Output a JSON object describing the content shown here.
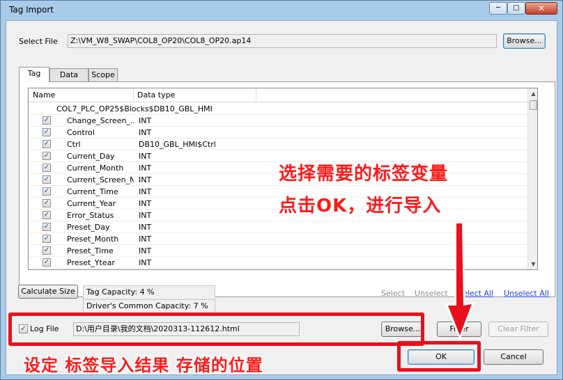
{
  "window": {
    "title": "Tag Import",
    "controls": {
      "minimize": "─",
      "maximize": "□",
      "close": "✕"
    }
  },
  "select_file": {
    "label": "Select File",
    "path": "Z:\\VM_W8_SWAP\\COL8_OP20\\COL8_OP20.ap14",
    "browse_label": "Browse..."
  },
  "tabs": [
    {
      "label": "Tag"
    },
    {
      "label": "Data type"
    },
    {
      "label": "Scope"
    }
  ],
  "list": {
    "columns": {
      "name": "Name",
      "type": "Data type"
    },
    "group": "COL7_PLC_OP25$Blocks$DB10_GBL_HMI",
    "rows": [
      {
        "name": "Change_Screen_...",
        "type": "INT",
        "checked": true
      },
      {
        "name": "Control",
        "type": "INT",
        "checked": true
      },
      {
        "name": "Ctrl",
        "type": "DB10_GBL_HMI$Ctrl",
        "checked": true
      },
      {
        "name": "Current_Day",
        "type": "INT",
        "checked": true
      },
      {
        "name": "Current_Month",
        "type": "INT",
        "checked": true
      },
      {
        "name": "Current_Screen_No",
        "type": "INT",
        "checked": true
      },
      {
        "name": "Current_Time",
        "type": "INT",
        "checked": true
      },
      {
        "name": "Current_Year",
        "type": "INT",
        "checked": true
      },
      {
        "name": "Error_Status",
        "type": "INT",
        "checked": true
      },
      {
        "name": "Preset_Day",
        "type": "INT",
        "checked": true
      },
      {
        "name": "Preset_Month",
        "type": "INT",
        "checked": true
      },
      {
        "name": "Preset_Time",
        "type": "INT",
        "checked": true
      },
      {
        "name": "Preset_Ytear",
        "type": "INT",
        "checked": true
      }
    ],
    "check_glyph": "✓"
  },
  "capacity": {
    "calculate_label": "Calculate Size",
    "tag_capacity": "Tag Capacity: 4 %",
    "driver_capacity": "Driver's Common Capacity: 7 %"
  },
  "selection": {
    "select": "Select",
    "unselect": "Unselect",
    "select_all": "Select All",
    "unselect_all": "Unselect All"
  },
  "log": {
    "label": "Log File",
    "checked": true,
    "path": "D:\\用户目录\\我的文档\\2020313-112612.html",
    "browse_label": "Browse..."
  },
  "filter": {
    "filter_label": "Filter",
    "clear_filter_label": "Clear Filter"
  },
  "footer": {
    "ok_label": "OK",
    "cancel_label": "Cancel"
  },
  "annotations": {
    "line1": "选择需要的标签变量",
    "line2": "点击OK，进行导入",
    "line3": "设定 标签导入结果 存储的位置",
    "color": "#e8101c"
  }
}
